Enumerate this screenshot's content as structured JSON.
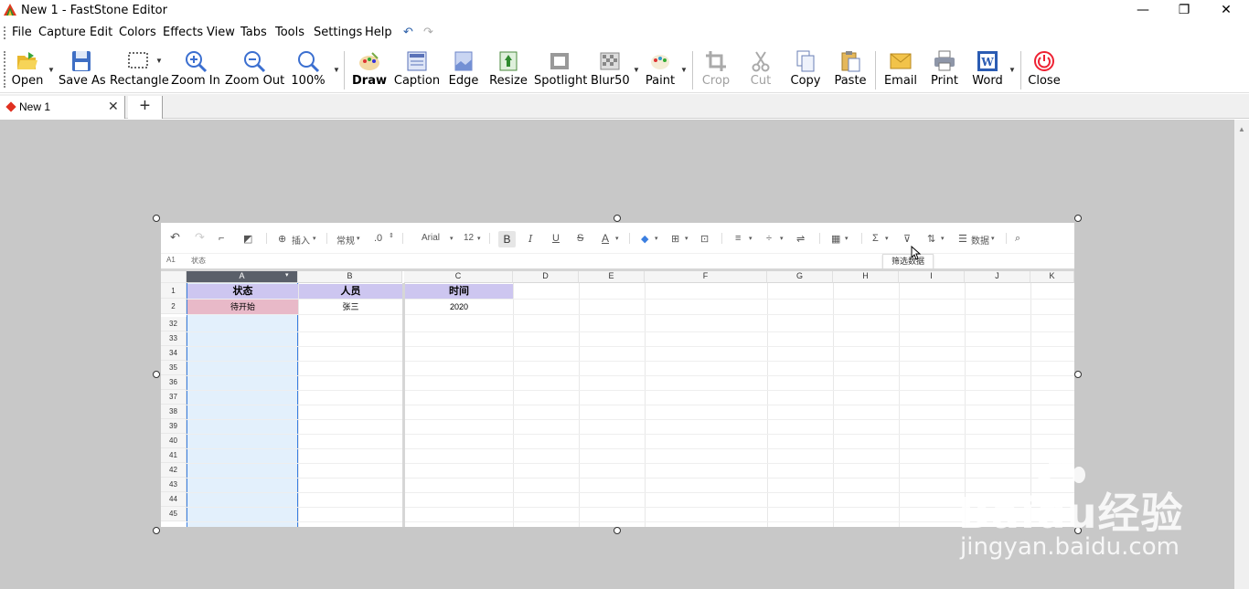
{
  "window": {
    "title": "New 1 - FastStone Editor",
    "minimize": "—",
    "restore": "❐",
    "close": "✕"
  },
  "menu": [
    "File",
    "Capture",
    "Edit",
    "Colors",
    "Effects",
    "View",
    "Tabs",
    "Tools",
    "Settings",
    "Help"
  ],
  "toolbar": {
    "open": "Open",
    "save_as": "Save As",
    "rectangle": "Rectangle",
    "zoom_in": "Zoom In",
    "zoom_out": "Zoom Out",
    "zoom_level": "100%",
    "draw": "Draw",
    "caption": "Caption",
    "edge": "Edge",
    "resize": "Resize",
    "spotlight": "Spotlight",
    "blur": "Blur50",
    "paint": "Paint",
    "crop": "Crop",
    "cut": "Cut",
    "copy": "Copy",
    "paste": "Paste",
    "email": "Email",
    "print": "Print",
    "word": "Word",
    "close": "Close"
  },
  "tabs": {
    "doc_tab": "New 1",
    "close_glyph": "✕",
    "new_tab": "+"
  },
  "sheet": {
    "toolbar": {
      "insert": "插入",
      "format": "常规",
      "decimal": ".0",
      "font": "Arial",
      "size": "12",
      "bold": "B",
      "data": "数据"
    },
    "tooltip": "筛选数据",
    "cell_ref": "A1",
    "formula": "状态",
    "columns": [
      "A",
      "B",
      "C",
      "D",
      "E",
      "F",
      "G",
      "H",
      "I",
      "J",
      "K"
    ],
    "rows_top": [
      "1",
      "2"
    ],
    "rows_bottom": [
      "32",
      "33",
      "34",
      "35",
      "36",
      "37",
      "38",
      "39",
      "40",
      "41",
      "42",
      "43",
      "44",
      "45"
    ],
    "header_row": [
      "状态",
      "人员",
      "时间"
    ],
    "data_row": [
      "待开始",
      "张三",
      "2020"
    ]
  },
  "watermark": {
    "brand": "Baidu经验",
    "url": "jingyan.baidu.com"
  },
  "colors": {
    "header_fill": "#cdc6f0",
    "status_fill": "#e8b9c8",
    "selected_col": "#e3f0fc",
    "accent": "#3b7fe0"
  }
}
